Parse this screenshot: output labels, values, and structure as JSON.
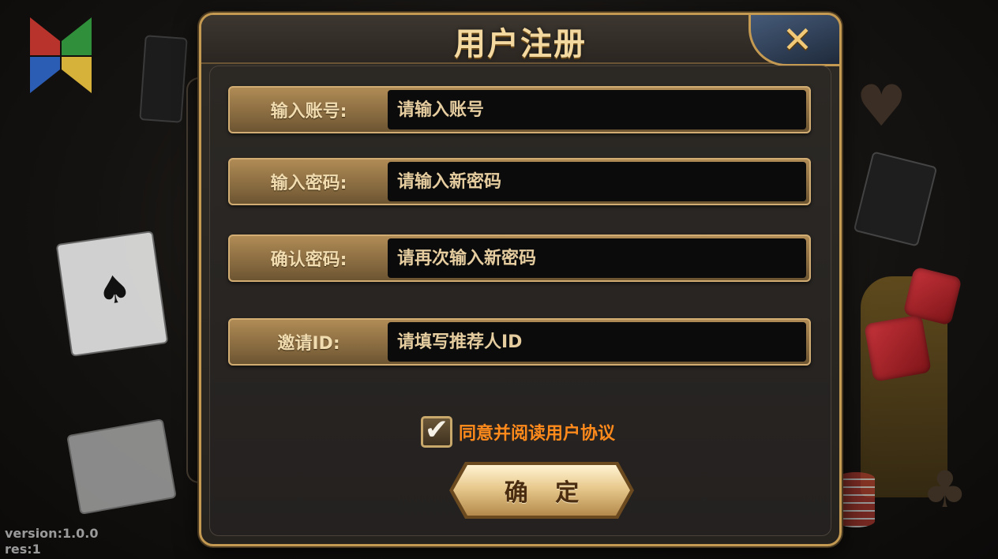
{
  "dialog": {
    "title": "用户注册",
    "close_icon": "close-x-icon"
  },
  "form": {
    "fields": [
      {
        "label": "输入账号:",
        "placeholder": "请输入账号",
        "value": ""
      },
      {
        "label": "输入密码:",
        "placeholder": "请输入新密码",
        "value": ""
      },
      {
        "label": "确认密码:",
        "placeholder": "请再次输入新密码",
        "value": ""
      },
      {
        "label": "邀请ID:",
        "placeholder": "请填写推荐人ID",
        "value": ""
      }
    ],
    "agreement": {
      "checked": true,
      "text": "同意并阅读用户协议"
    },
    "confirm_label": "确 定"
  },
  "footer": {
    "version": "version:1.0.0",
    "res": "res:1"
  },
  "colors": {
    "accent_gold": "#c49a52",
    "agreement_text": "#ff8a1c",
    "close_button": "#2f3d55"
  }
}
